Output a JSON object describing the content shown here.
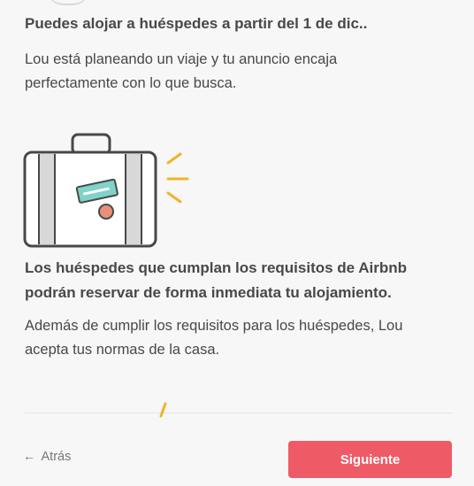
{
  "section1": {
    "title": "Puedes alojar a huéspedes a partir del 1 de dic..",
    "body": "Lou está planeando un viaje y tu anuncio encaja perfectamente con lo que busca."
  },
  "section2": {
    "title": "Los huéspedes que cumplan los requisitos de Airbnb podrán reservar de forma inmediata tu alojamiento.",
    "body": "Además de cumplir los requisitos para los huéspedes, Lou acepta tus normas de la casa."
  },
  "illustration": {
    "icon": "suitcase-icon"
  },
  "footer": {
    "back_label": "Atrás",
    "next_label": "Siguiente"
  },
  "colors": {
    "accent": "#ef5a67",
    "teal": "#7fd3c8",
    "orange": "#e8907a",
    "yellow": "#f0b429"
  }
}
